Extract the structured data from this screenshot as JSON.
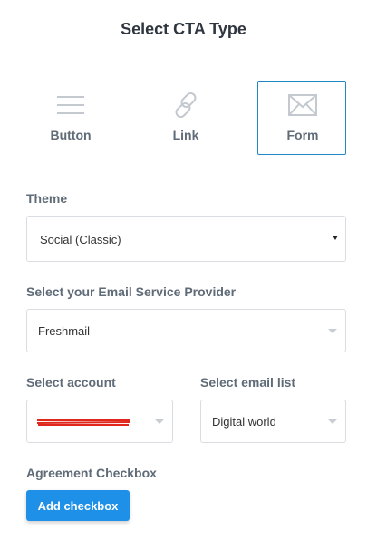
{
  "dialog": {
    "title": "Select CTA Type"
  },
  "cta_types": [
    {
      "label": "Button",
      "icon": "menu-lines-icon"
    },
    {
      "label": "Link",
      "icon": "link-icon"
    },
    {
      "label": "Form",
      "icon": "envelope-icon",
      "selected": true
    }
  ],
  "theme": {
    "label": "Theme",
    "value": "Social (Classic)"
  },
  "provider": {
    "label": "Select your Email Service Provider",
    "value": "Freshmail"
  },
  "account": {
    "label": "Select account",
    "value": "redacted"
  },
  "email_list": {
    "label": "Select email list",
    "value": "Digital world"
  },
  "agreement": {
    "label": "Agreement Checkbox",
    "button_label": "Add checkbox"
  },
  "colors": {
    "accent": "#1e90e8",
    "selected_border": "#1e88c7",
    "label": "#5f6b77",
    "redaction": "#e0271d"
  }
}
